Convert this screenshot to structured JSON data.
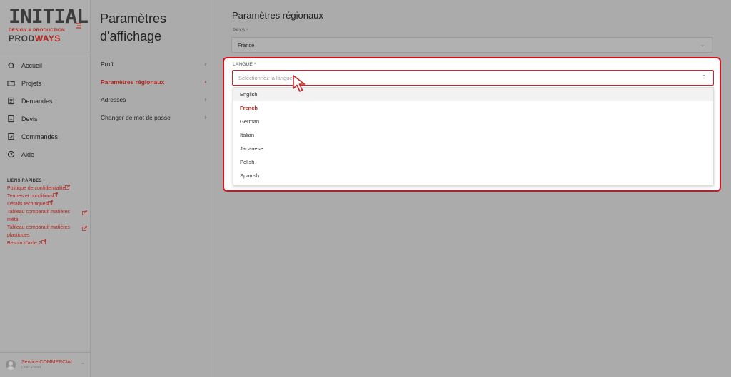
{
  "brand": {
    "logo_line1": "INITIAL",
    "logo_line2": "DESIGN & PRODUCTION",
    "logo_line3_a": "PRO",
    "logo_line3_b": "D",
    "logo_line3_c": "WAYS",
    "accent_color": "#b3261e"
  },
  "nav": {
    "items": [
      {
        "label": "Accueil",
        "icon": "home-icon"
      },
      {
        "label": "Projets",
        "icon": "folder-icon"
      },
      {
        "label": "Demandes",
        "icon": "requests-icon"
      },
      {
        "label": "Devis",
        "icon": "quote-icon"
      },
      {
        "label": "Commandes",
        "icon": "orders-icon"
      },
      {
        "label": "Aide",
        "icon": "help-icon"
      }
    ]
  },
  "quick_links": {
    "title": "LIENS RAPIDES",
    "items": [
      "Politique de confidentialité",
      "Termes et conditions",
      "Détails techniques",
      "Tableau comparatif matières métal",
      "Tableau comparatif matières plastiques",
      "Besoin d'aide ?"
    ]
  },
  "user": {
    "name": "Service COMMERCIAL",
    "role": "User Panel"
  },
  "settings": {
    "title_line1": "Paramètres",
    "title_line2": "d'affichage",
    "menu": [
      {
        "label": "Profil",
        "active": false
      },
      {
        "label": "Paramètres régionaux",
        "active": true
      },
      {
        "label": "Adresses",
        "active": false
      },
      {
        "label": "Changer de mot de passe",
        "active": false
      }
    ]
  },
  "main": {
    "title": "Paramètres régionaux",
    "country": {
      "label": "PAYS *",
      "value": "France"
    },
    "language": {
      "label": "LANGUE *",
      "placeholder": "Sélectionnez la langue",
      "options": [
        "English",
        "French",
        "German",
        "Italian",
        "Japanese",
        "Polish",
        "Spanish"
      ],
      "selected": "French",
      "hovered": "English"
    }
  }
}
